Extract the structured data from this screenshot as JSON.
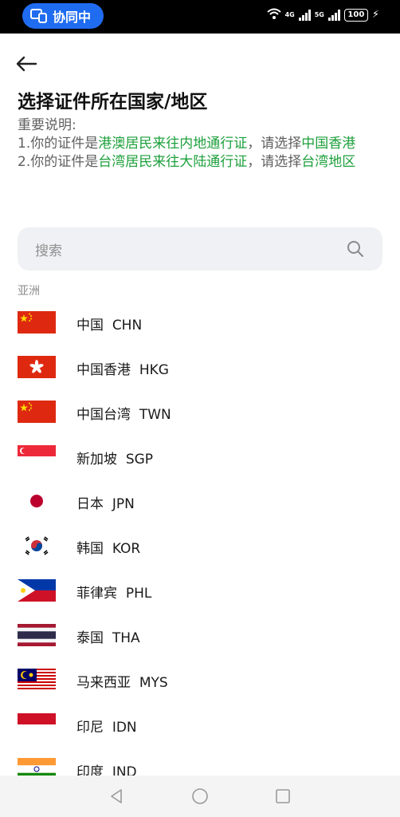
{
  "status_bar": {
    "collab_label": "协同中",
    "network_1": "4G",
    "network_2": "5G",
    "battery": "100"
  },
  "page": {
    "title": "选择证件所在国家/地区",
    "notice_heading": "重要说明:",
    "line1_prefix": "1.你的证件是",
    "line1_doc": "港澳居民来往内地通行证",
    "line1_mid": "，请选择",
    "line1_choice": "中国香港",
    "line2_prefix": "2.你的证件是",
    "line2_doc": "台湾居民来往大陆通行证",
    "line2_mid": "，请选择",
    "line2_choice": "台湾地区",
    "accent_color": "#1ea03c"
  },
  "search": {
    "placeholder": "搜索"
  },
  "section_label": "亚洲",
  "countries": [
    {
      "name": "中国",
      "code": "CHN"
    },
    {
      "name": "中国香港",
      "code": "HKG"
    },
    {
      "name": "中国台湾",
      "code": "TWN"
    },
    {
      "name": "新加坡",
      "code": "SGP"
    },
    {
      "name": "日本",
      "code": "JPN"
    },
    {
      "name": "韩国",
      "code": "KOR"
    },
    {
      "name": "菲律宾",
      "code": "PHL"
    },
    {
      "name": "泰国",
      "code": "THA"
    },
    {
      "name": "马来西亚",
      "code": "MYS"
    },
    {
      "name": "印尼",
      "code": "IDN"
    },
    {
      "name": "印度",
      "code": "IND"
    }
  ]
}
